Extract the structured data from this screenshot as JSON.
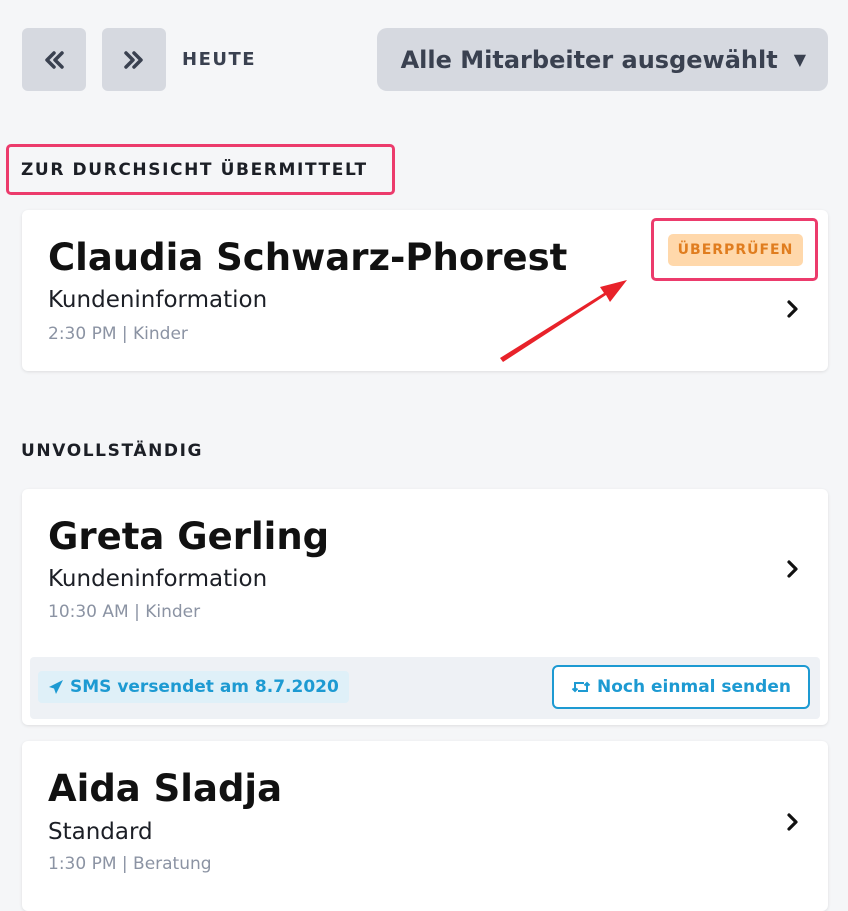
{
  "toolbar": {
    "prev_icon": "double-chevron-left-icon",
    "next_icon": "double-chevron-right-icon",
    "today_label": "HEUTE",
    "employee_select": "Alle Mitarbeiter ausgewählt",
    "caret_glyph": "▼"
  },
  "sections": {
    "submitted": {
      "label": "ZUR DURCHSICHT ÜBERMITTELT",
      "cards": [
        {
          "name": "Claudia Schwarz-Phorest",
          "type": "Kundeninformation",
          "meta": "2:30 PM | Kinder",
          "badge": "ÜBERPRÜFEN"
        }
      ]
    },
    "incomplete": {
      "label": "UNVOLLSTÄNDIG",
      "cards": [
        {
          "name": "Greta Gerling",
          "type": "Kundeninformation",
          "meta": "10:30 AM | Kinder",
          "sms_status": "SMS versendet am 8.7.2020",
          "resend_label": "Noch einmal senden"
        },
        {
          "name": "Aida Sladja",
          "type": "Standard",
          "meta": "1:30 PM | Beratung"
        }
      ]
    }
  },
  "colors": {
    "highlight": "#ec3b6c",
    "arrow": "#e8222a",
    "badge_bg": "#ffd8ab",
    "badge_text": "#e07d1f",
    "sms_accent": "#1d9ad2"
  }
}
